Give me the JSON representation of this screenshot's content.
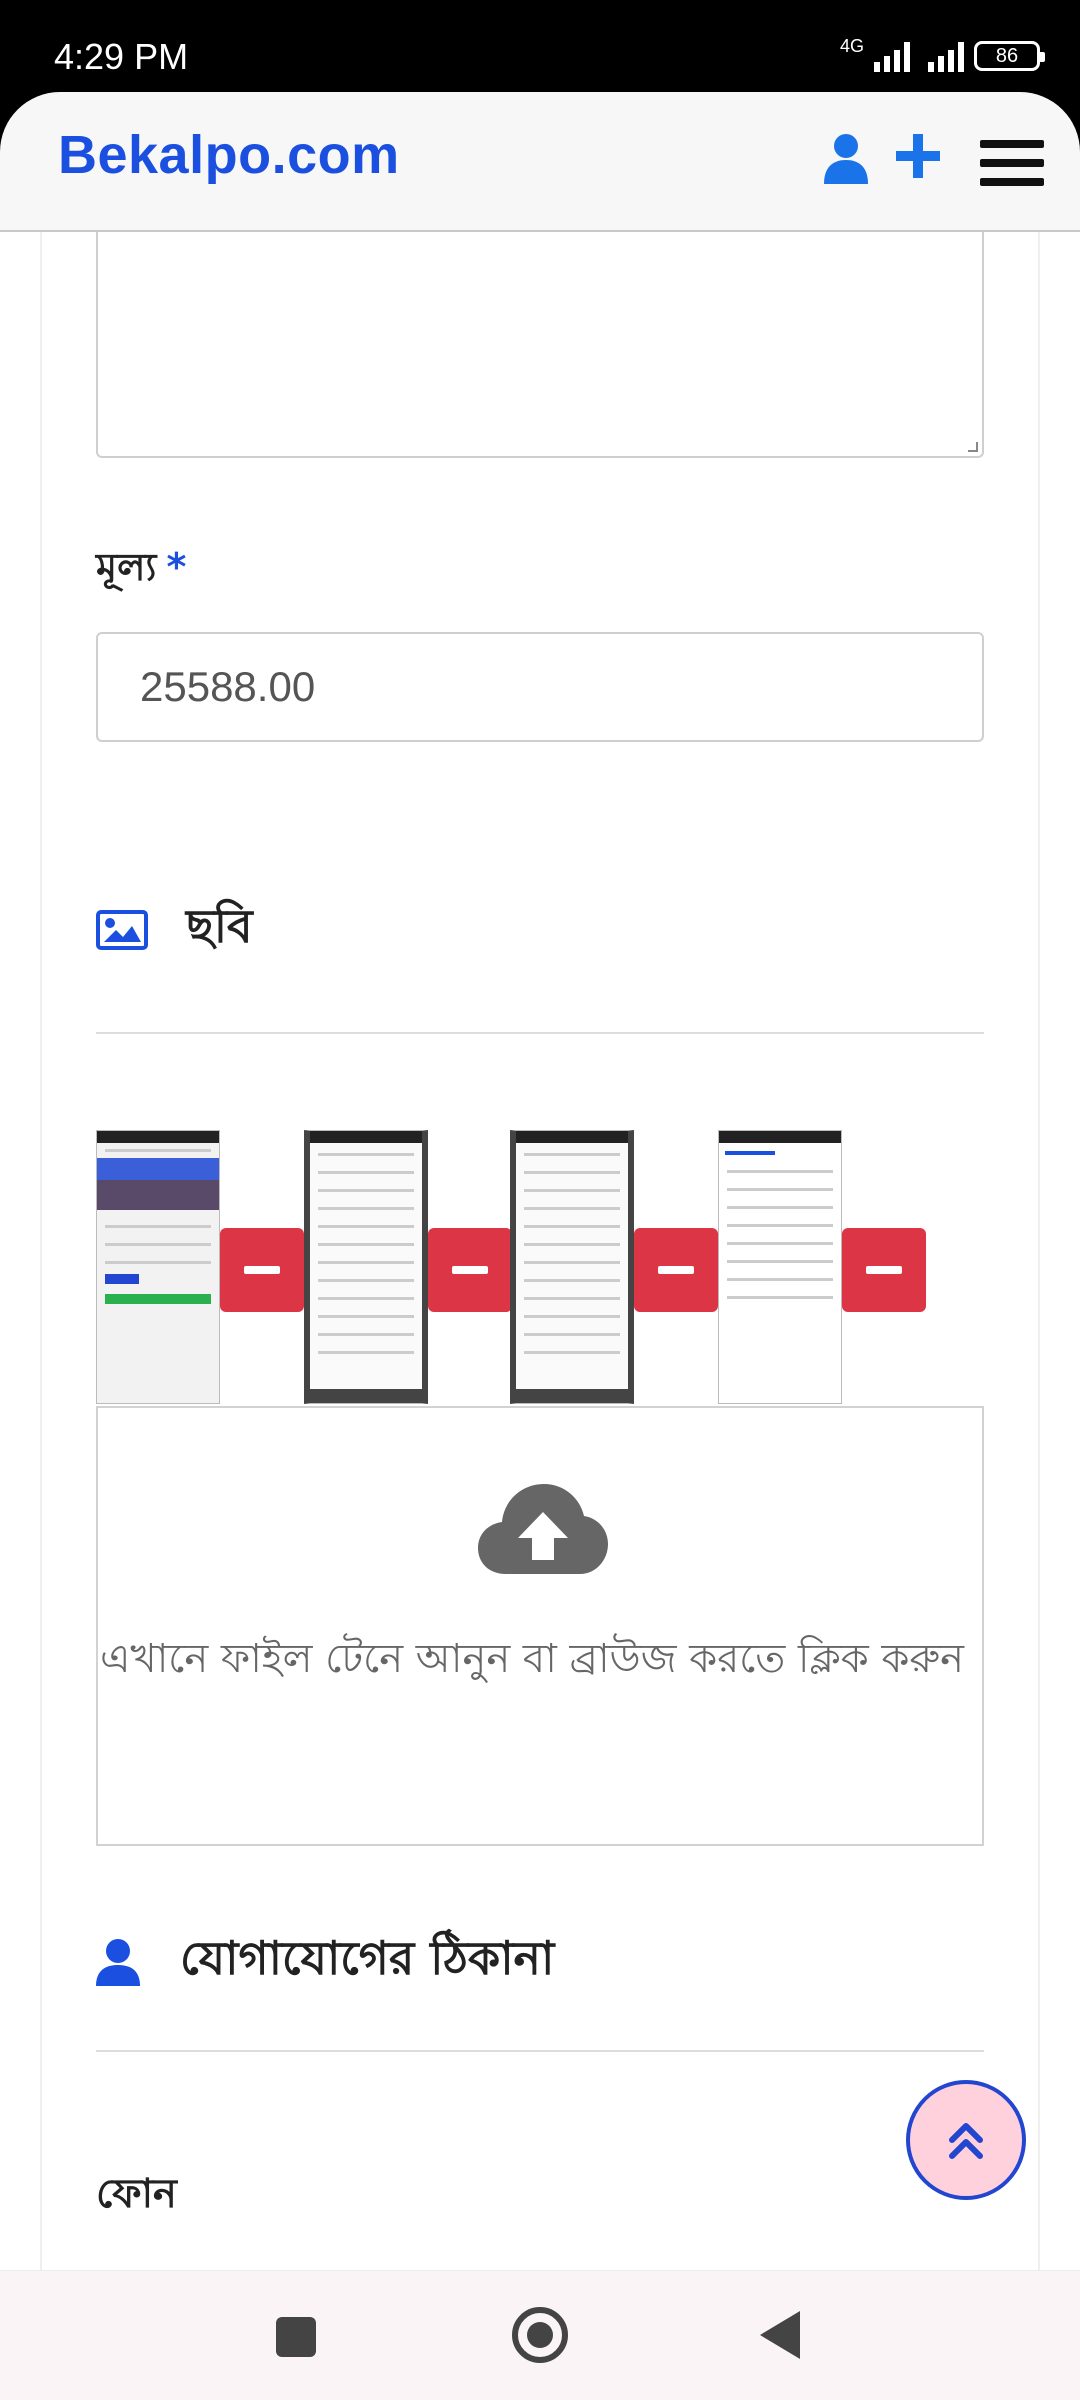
{
  "status_bar": {
    "time": "4:29 PM",
    "network": "4G",
    "battery": "86"
  },
  "header": {
    "brand": "Bekalpo.com",
    "icons": [
      "user-icon",
      "plus-icon",
      "hamburger-menu-icon"
    ]
  },
  "form": {
    "price_label": "মূল্য",
    "required_marker": "*",
    "price_value": "25588.00"
  },
  "images_section": {
    "title": "ছবি",
    "icon": "image-icon",
    "thumbnails_count": 4,
    "dropzone_text": "এখানে ফাইল টেনে আনুন বা ব্রাউজ করতে ক্লিক করুন"
  },
  "contact_section": {
    "title": "যোগাযোগের ঠিকানা",
    "icon": "user-icon",
    "phone_label": "ফোন"
  },
  "colors": {
    "brand_blue": "#1a4fe0",
    "remove_red": "#dc3545",
    "back_top_bg": "#ffd1dc"
  }
}
